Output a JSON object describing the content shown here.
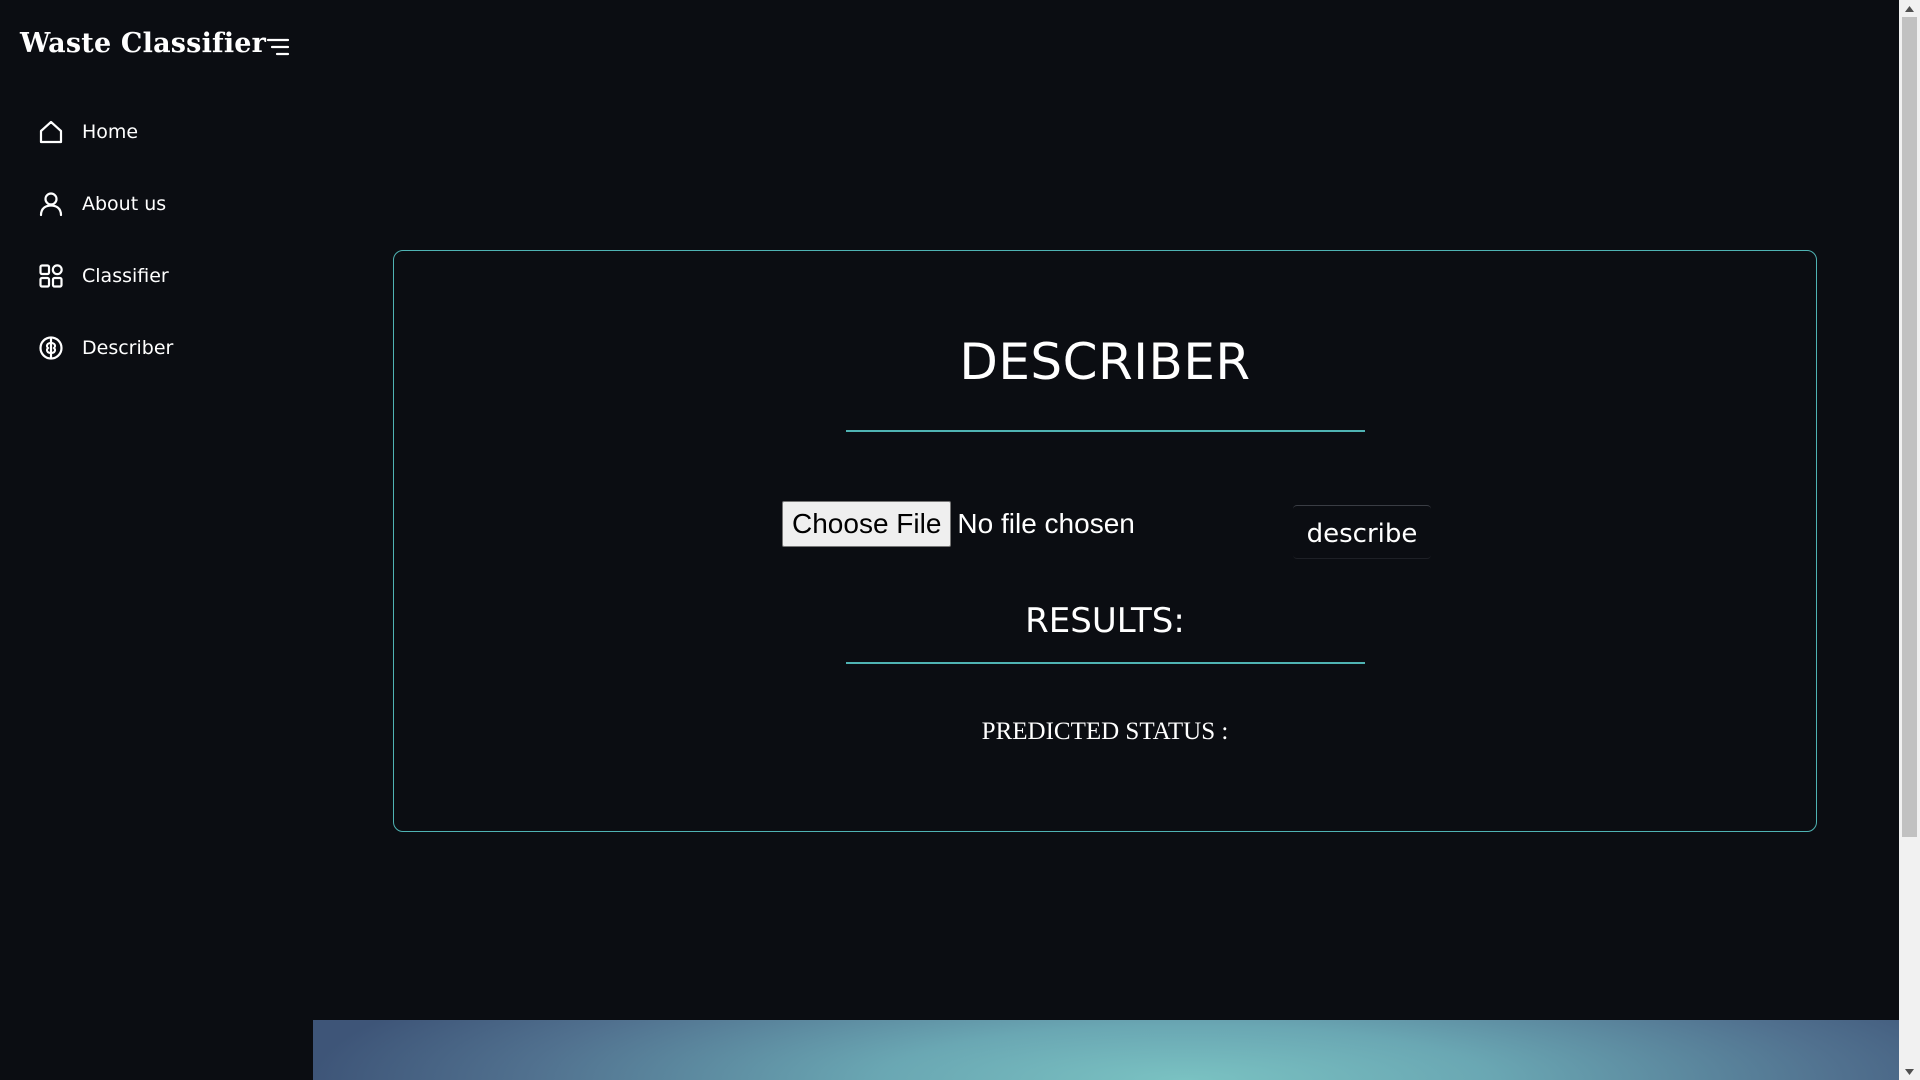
{
  "sidebar": {
    "brand": "Waste Classifier",
    "menu_toggle_icon": "menu-lines-icon",
    "items": [
      {
        "label": "Home",
        "icon": "home-icon"
      },
      {
        "label": "About us",
        "icon": "user-icon"
      },
      {
        "label": "Classifier",
        "icon": "grid-icon"
      },
      {
        "label": "Describer",
        "icon": "brain-icon"
      }
    ]
  },
  "main": {
    "title": "DESCRIBER",
    "file_input": {
      "button_label": "Choose File",
      "status": "No file chosen"
    },
    "describe_button": "describe",
    "results_title": "RESULTS:",
    "predicted_status_label": "PREDICTED STATUS :"
  },
  "colors": {
    "background": "#0b0d12",
    "accent": "#4fb3b3",
    "text": "#ffffff"
  }
}
